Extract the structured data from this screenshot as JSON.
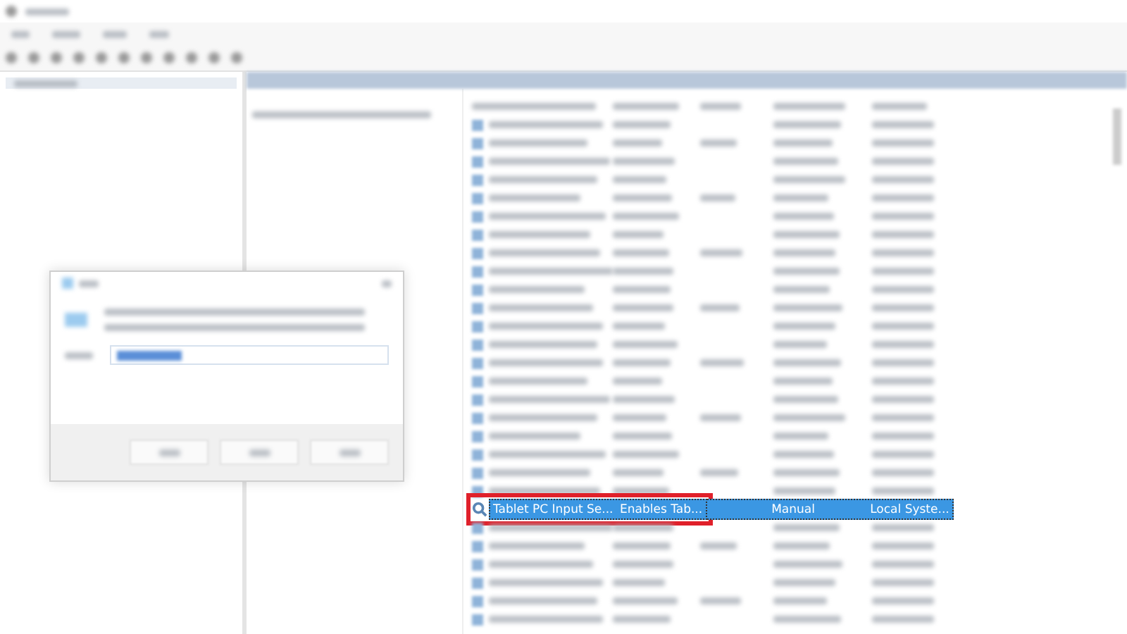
{
  "services": {
    "rows": [
      {
        "name": "Tablet PC Input Se...",
        "description": "Enables Tab...",
        "status": "",
        "startup_type": "Manual",
        "log_on_as": "Local Syste...",
        "selected": true,
        "highlighted": true
      }
    ]
  }
}
